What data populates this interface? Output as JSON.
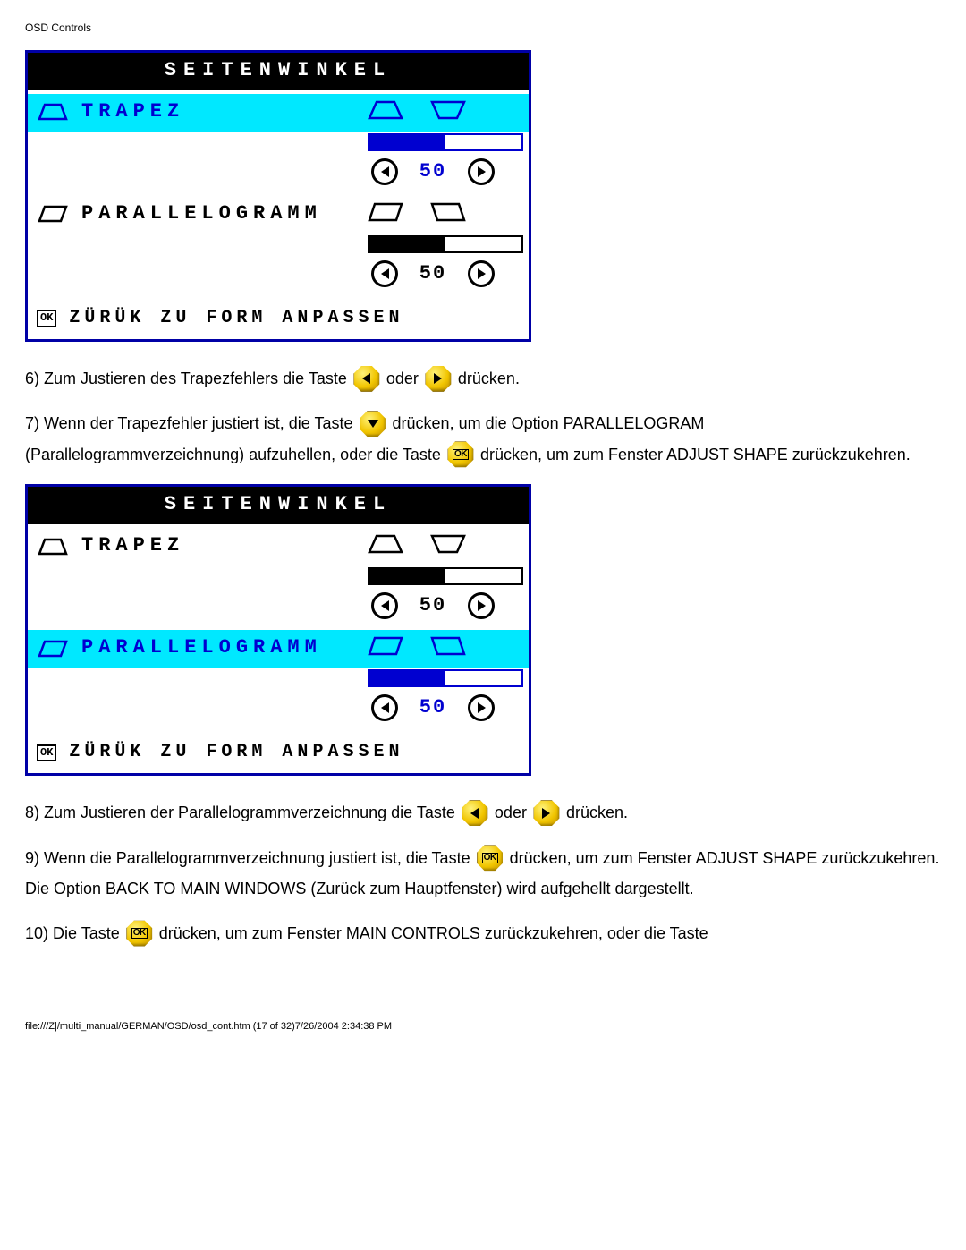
{
  "page_header": "OSD Controls",
  "osd1": {
    "title": "SEITENWINKEL",
    "items": [
      {
        "label": "TRAPEZ",
        "selected": true,
        "value": "50"
      },
      {
        "label": "PARALLELOGRAMM",
        "selected": false,
        "value": "50"
      }
    ],
    "footer_ok": "OK",
    "footer_text": "ZÜRÜK ZU FORM ANPASSEN"
  },
  "osd2": {
    "title": "SEITENWINKEL",
    "items": [
      {
        "label": "TRAPEZ",
        "selected": false,
        "value": "50"
      },
      {
        "label": "PARALLELOGRAMM",
        "selected": true,
        "value": "50"
      }
    ],
    "footer_ok": "OK",
    "footer_text": "ZÜRÜK ZU FORM ANPASSEN"
  },
  "text": {
    "p6a": "6) Zum Justieren des Trapezfehlers die Taste ",
    "p6b": " oder ",
    "p6c": " drücken.",
    "p7a": "7) Wenn der Trapezfehler justiert ist, die Taste ",
    "p7b": " drücken, um die Option PARALLELOGRAM",
    "p7c": "(Parallelogrammverzeichnung) aufzuhellen, oder die Taste ",
    "p7d": " drücken, um zum Fenster ADJUST SHAPE zurückzukehren.",
    "p8a": "8) Zum Justieren der Parallelogrammverzeichnung die Taste ",
    "p8b": " oder ",
    "p8c": " drücken.",
    "p9a": "9) Wenn die Parallelogrammverzeichnung justiert ist, die Taste ",
    "p9b": " drücken, um zum Fenster ADJUST SHAPE zurückzukehren. Die Option BACK TO MAIN WINDOWS (Zurück zum Hauptfenster) wird aufgehellt dargestellt.",
    "p10a": "10) Die Taste ",
    "p10b": " drücken, um zum Fenster MAIN CONTROLS zurückzukehren, oder die Taste"
  },
  "footer_line": "file:///Z|/multi_manual/GERMAN/OSD/osd_cont.htm (17 of 32)7/26/2004 2:34:38 PM"
}
